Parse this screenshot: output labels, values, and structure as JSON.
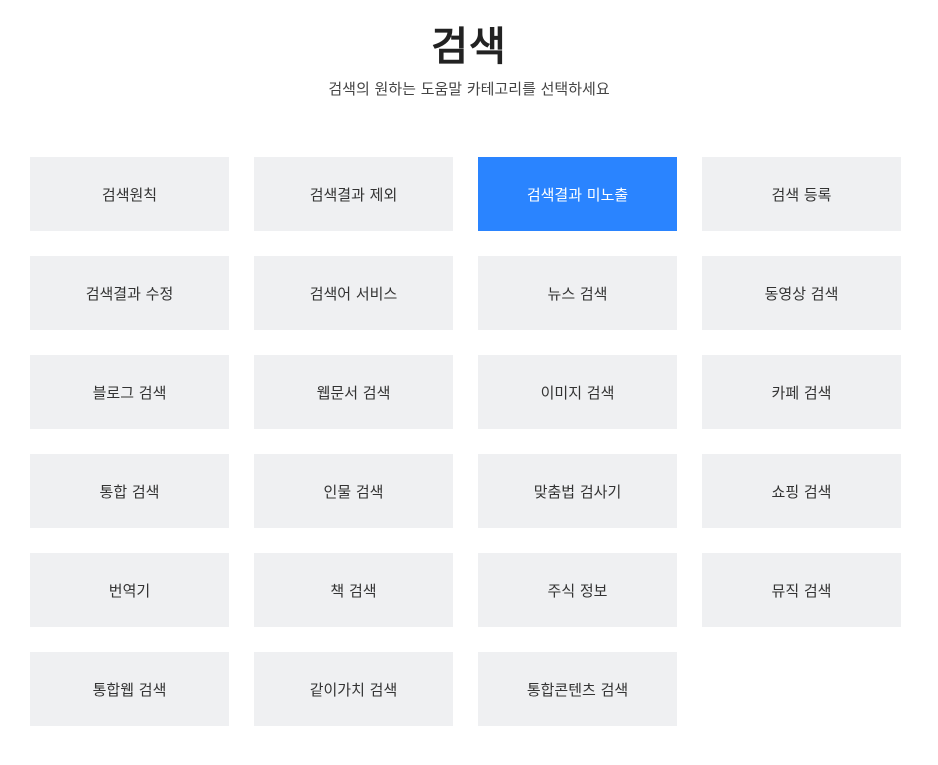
{
  "header": {
    "title": "검색",
    "subtitle": "검색의 원하는 도움말 카테고리를 선택하세요"
  },
  "colors": {
    "active_background": "#2a84ff",
    "item_background": "#eff0f2",
    "active_text": "#ffffff"
  },
  "categories": [
    {
      "label": "검색원칙",
      "active": false
    },
    {
      "label": "검색결과 제외",
      "active": false
    },
    {
      "label": "검색결과 미노출",
      "active": true
    },
    {
      "label": "검색 등록",
      "active": false
    },
    {
      "label": "검색결과 수정",
      "active": false
    },
    {
      "label": "검색어 서비스",
      "active": false
    },
    {
      "label": "뉴스 검색",
      "active": false
    },
    {
      "label": "동영상 검색",
      "active": false
    },
    {
      "label": "블로그 검색",
      "active": false
    },
    {
      "label": "웹문서 검색",
      "active": false
    },
    {
      "label": "이미지 검색",
      "active": false
    },
    {
      "label": "카페 검색",
      "active": false
    },
    {
      "label": "통합 검색",
      "active": false
    },
    {
      "label": "인물 검색",
      "active": false
    },
    {
      "label": "맞춤법 검사기",
      "active": false
    },
    {
      "label": "쇼핑 검색",
      "active": false
    },
    {
      "label": "번역기",
      "active": false
    },
    {
      "label": "책 검색",
      "active": false
    },
    {
      "label": "주식 정보",
      "active": false
    },
    {
      "label": "뮤직 검색",
      "active": false
    },
    {
      "label": "통합웹 검색",
      "active": false
    },
    {
      "label": "같이가치 검색",
      "active": false
    },
    {
      "label": "통합콘텐츠 검색",
      "active": false
    }
  ]
}
